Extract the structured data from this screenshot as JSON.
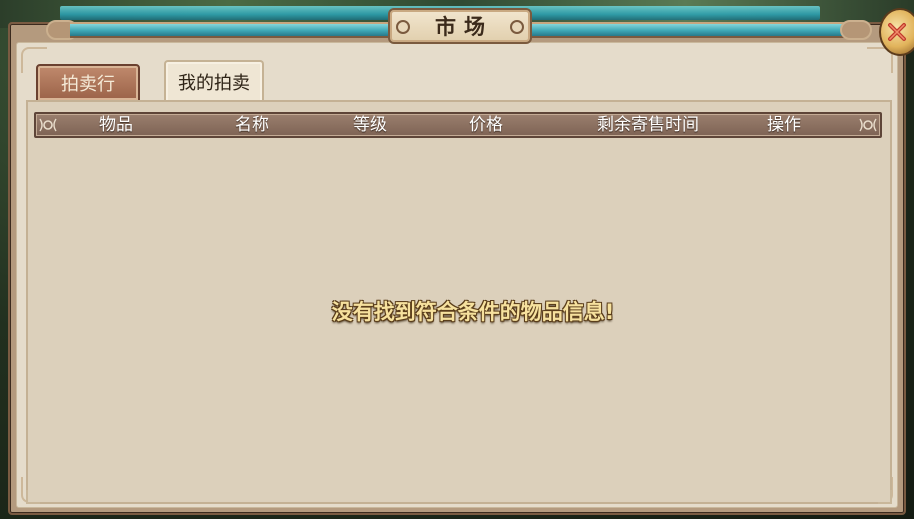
{
  "window": {
    "title": "市场",
    "close_icon": "close-x-icon"
  },
  "tabs": [
    {
      "label": "拍卖行",
      "active": false
    },
    {
      "label": "我的拍卖",
      "active": true
    }
  ],
  "table": {
    "columns": [
      "物品",
      "名称",
      "等级",
      "价格",
      "剩余寄售时间",
      "操作"
    ],
    "rows": []
  },
  "empty_message": "没有找到符合条件的物品信息!",
  "colors": {
    "panel_bg": "#e5dccb",
    "header_bg": "#8a6f60",
    "title_strip": "#3fa7b5",
    "tab_inactive": "#a86f55",
    "message_text": "#f6e19e"
  }
}
